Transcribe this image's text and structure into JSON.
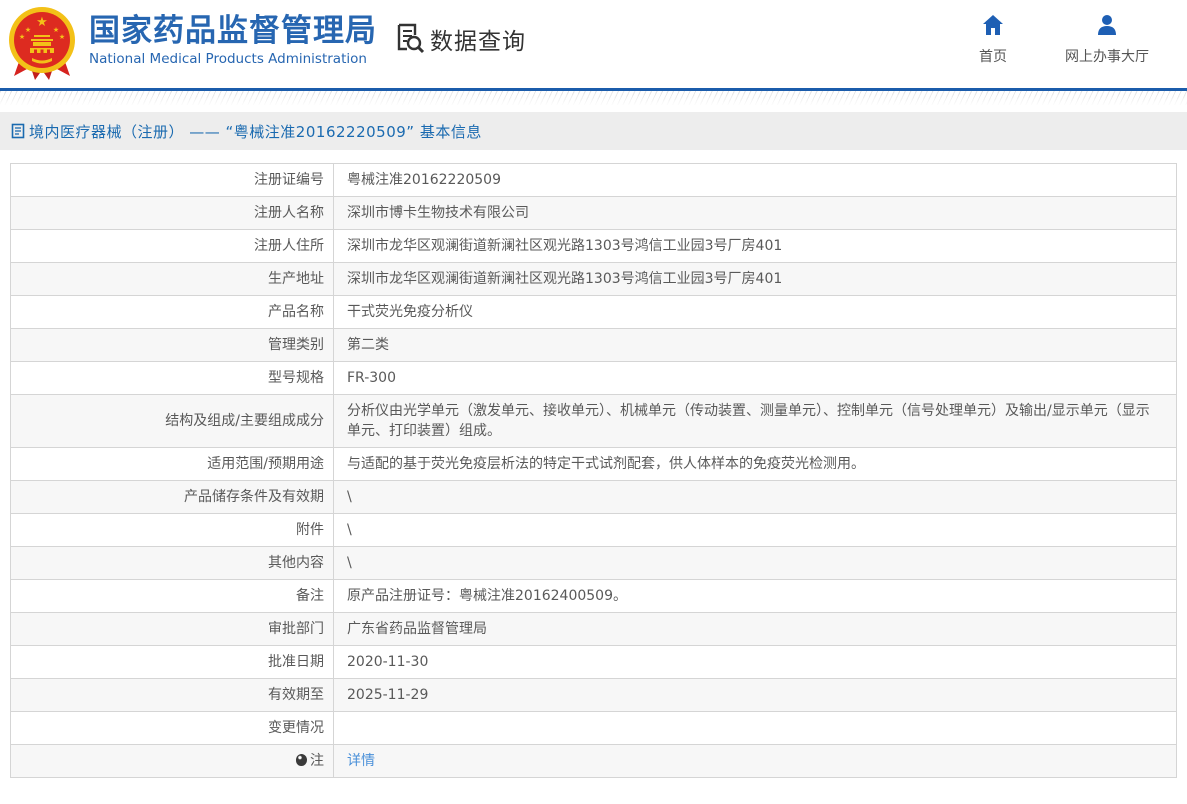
{
  "header": {
    "org_name_zh": "国家药品监督管理局",
    "org_name_en": "National Medical Products Administration",
    "query_title": "数据查询",
    "nav_items": [
      {
        "label": "首页",
        "icon": "home-icon"
      },
      {
        "label": "网上办事大厅",
        "icon": "person-icon"
      }
    ]
  },
  "breadcrumb": {
    "text": "境内医疗器械（注册） —— “粤械注准20162220509” 基本信息"
  },
  "table": {
    "rows": [
      {
        "label": "注册证编号",
        "value": "粤械注准20162220509"
      },
      {
        "label": "注册人名称",
        "value": "深圳市博卡生物技术有限公司"
      },
      {
        "label": "注册人住所",
        "value": "深圳市龙华区观澜街道新澜社区观光路1303号鸿信工业园3号厂房401"
      },
      {
        "label": "生产地址",
        "value": "深圳市龙华区观澜街道新澜社区观光路1303号鸿信工业园3号厂房401"
      },
      {
        "label": "产品名称",
        "value": "干式荧光免疫分析仪"
      },
      {
        "label": "管理类别",
        "value": "第二类"
      },
      {
        "label": "型号规格",
        "value": "FR-300"
      },
      {
        "label": "结构及组成/主要组成成分",
        "value": "分析仪由光学单元（激发单元、接收单元）、机械单元（传动装置、测量单元）、控制单元（信号处理单元）及输出/显示单元（显示单元、打印装置）组成。"
      },
      {
        "label": "适用范围/预期用途",
        "value": "与适配的基于荧光免疫层析法的特定干式试剂配套，供人体样本的免疫荧光检测用。"
      },
      {
        "label": "产品储存条件及有效期",
        "value": "\\"
      },
      {
        "label": "附件",
        "value": "\\"
      },
      {
        "label": "其他内容",
        "value": "\\"
      },
      {
        "label": "备注",
        "value": "原产品注册证号：粤械注准20162400509。"
      },
      {
        "label": "审批部门",
        "value": "广东省药品监督管理局"
      },
      {
        "label": "批准日期",
        "value": "2020-11-30"
      },
      {
        "label": "有效期至",
        "value": "2025-11-29"
      },
      {
        "label": "变更情况",
        "value": ""
      },
      {
        "label": "注",
        "label_icon": "note-balloon-icon",
        "value": "详情",
        "value_is_link": true
      }
    ]
  },
  "colors": {
    "brand_blue": "#2766b1",
    "nav_icon_blue": "#1e5fb4",
    "top_line_blue": "#1b5cab",
    "breadcrumb_text_blue": "#1a6ab0",
    "link_blue": "#4a90d9",
    "alt_row_bg": "#f7f7f7"
  }
}
